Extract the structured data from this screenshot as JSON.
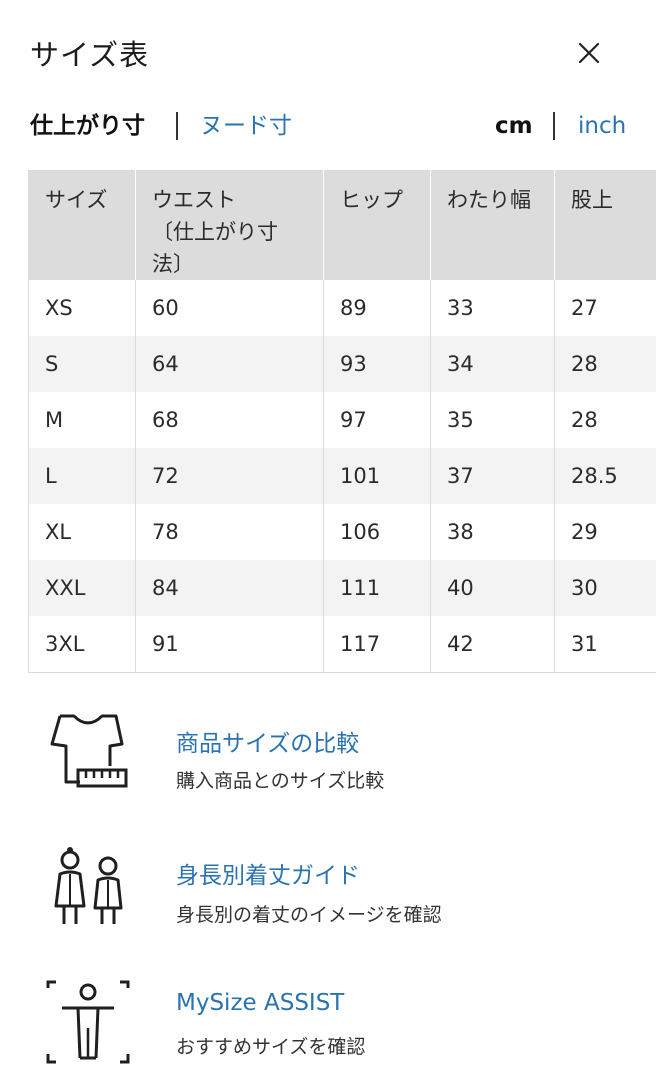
{
  "header": {
    "title": "サイズ表"
  },
  "measure_type": {
    "active": "仕上がり寸",
    "inactive": "ヌード寸"
  },
  "units": {
    "active": "cm",
    "inactive": "inch"
  },
  "table": {
    "headers": [
      "サイズ",
      "ウエスト",
      "〔仕上がり寸法〕",
      "ヒップ",
      "わたり幅",
      "股上"
    ],
    "rows": [
      [
        "XS",
        "60",
        "89",
        "33",
        "27"
      ],
      [
        "S",
        "64",
        "93",
        "34",
        "28"
      ],
      [
        "M",
        "68",
        "97",
        "35",
        "28"
      ],
      [
        "L",
        "72",
        "101",
        "37",
        "28.5"
      ],
      [
        "XL",
        "78",
        "106",
        "38",
        "29"
      ],
      [
        "XXL",
        "84",
        "111",
        "40",
        "30"
      ],
      [
        "3XL",
        "91",
        "117",
        "42",
        "31"
      ]
    ]
  },
  "links": [
    {
      "title": "商品サイズの比較",
      "desc": "購入商品とのサイズ比較",
      "icon": "tshirt-ruler-icon"
    },
    {
      "title": "身長別着丈ガイド",
      "desc": "身長別の着丈のイメージを確認",
      "icon": "two-figures-icon"
    },
    {
      "title": "MySize ASSIST",
      "desc": "おすすめサイズを確認",
      "icon": "person-scan-icon"
    }
  ]
}
